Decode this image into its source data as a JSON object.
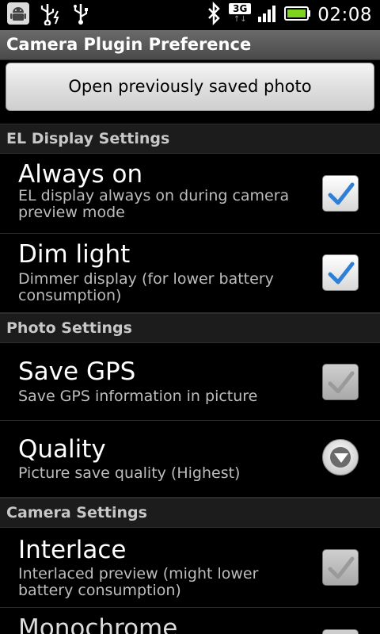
{
  "status_bar": {
    "time": "02:08",
    "network": "3G",
    "left_icons": [
      "android-icon",
      "usb-debug-icon",
      "usb-icon"
    ],
    "right_icons": [
      "bluetooth-icon",
      "signal-icon",
      "battery-icon"
    ]
  },
  "title_bar": {
    "title": "Camera Plugin Preference"
  },
  "open_button": {
    "label": "Open previously saved photo"
  },
  "sections": [
    {
      "header": "EL Display Settings",
      "items": [
        {
          "title": "Always on",
          "summary": "EL display always on during camera preview mode",
          "control": "checkbox",
          "checked": true,
          "enabled": true
        },
        {
          "title": "Dim light",
          "summary": "Dimmer display (for lower battery consumption)",
          "control": "checkbox",
          "checked": true,
          "enabled": true
        }
      ]
    },
    {
      "header": "Photo Settings",
      "items": [
        {
          "title": "Save GPS",
          "summary": "Save GPS information in picture",
          "control": "checkbox",
          "checked": true,
          "enabled": false
        },
        {
          "title": "Quality",
          "summary": "Picture save quality (Highest)",
          "control": "dropdown"
        }
      ]
    },
    {
      "header": "Camera Settings",
      "items": [
        {
          "title": "Interlace",
          "summary": "Interlaced preview (might lower battery consumption)",
          "control": "checkbox",
          "checked": true,
          "enabled": false
        },
        {
          "title": "Monochrome",
          "summary": "",
          "control": "checkbox",
          "checked": false,
          "enabled": false
        }
      ]
    }
  ],
  "colors": {
    "accent_check": "#2f7fd6",
    "disabled_check": "#9a9a9a",
    "battery": "#7ed31f"
  }
}
